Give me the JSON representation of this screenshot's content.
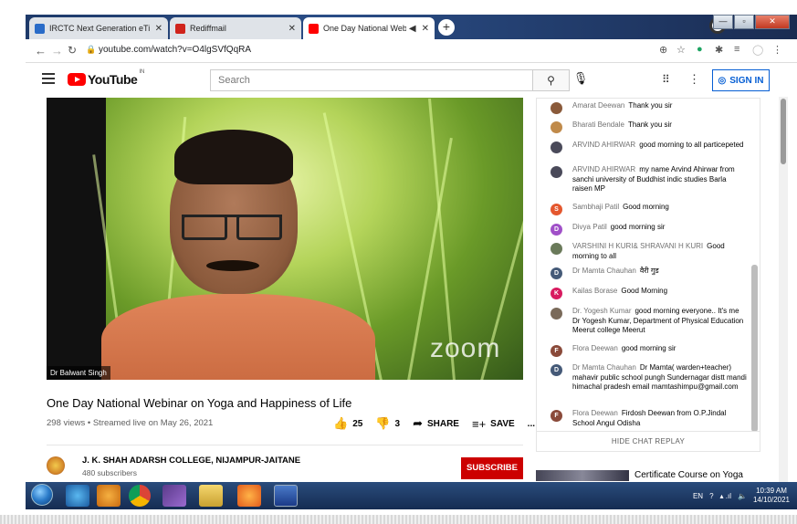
{
  "browser": {
    "tabs": [
      {
        "label": "IRCTC Next Generation eTicketing",
        "favicon_color": "#2a6cc8",
        "active": false
      },
      {
        "label": "Rediffmail",
        "favicon_color": "#d0241c",
        "active": false
      },
      {
        "label": "One Day National Webinar on",
        "favicon_color": "#ff0000",
        "active": true
      }
    ],
    "url": "youtube.com/watch?v=O4lgSVfQqRA",
    "new_tab_glyph": "+"
  },
  "youtube": {
    "logo_text": "YouTube",
    "country_code": "IN",
    "search_placeholder": "Search",
    "sign_in_label": "SIGN IN"
  },
  "video": {
    "speaker_tag": "Dr Balwant Singh",
    "watermark": "zoom",
    "title": "One Day National Webinar on Yoga and Happiness of Life",
    "meta": "298 views • Streamed live on May 26, 2021",
    "likes": "25",
    "dislikes": "3",
    "share_label": "SHARE",
    "save_label": "SAVE",
    "more_label": "..."
  },
  "channel": {
    "name": "J. K. SHAH ADARSH COLLEGE, NIJAMPUR-JAITANE",
    "subscribers": "480 subscribers",
    "subscribe_label": "SUBSCRIBE"
  },
  "chat": {
    "hide_label": "HIDE CHAT REPLAY",
    "messages": [
      {
        "author": "Amarat Deewan",
        "text": "Thank you sir",
        "avatar": "",
        "color": "#8a5a3a"
      },
      {
        "author": "Bharati Bendale",
        "text": "Thank you sir",
        "avatar": "",
        "color": "#c08a4a"
      },
      {
        "author": "ARVIND AHIRWAR",
        "text": "good morning to all particepeted",
        "avatar": "",
        "color": "#4a4a5a"
      },
      {
        "author": "ARVIND AHIRWAR",
        "text": "my name Arvind Ahirwar from sanchi university of Buddhist indic studies Barla raisen MP",
        "avatar": "",
        "color": "#4a4a5a"
      },
      {
        "author": "Sambhaji Patil",
        "text": "Good morning",
        "avatar": "S",
        "color": "#e4572e"
      },
      {
        "author": "Divya Patil",
        "text": "good morning sir",
        "avatar": "D",
        "color": "#a050c8"
      },
      {
        "author": "VARSHINI H KURI& SHRAVANI H KURI",
        "text": "Good morning to all",
        "avatar": "",
        "color": "#6a7a5a"
      },
      {
        "author": "Dr Mamta Chauhan",
        "text": "वैरी गुड",
        "avatar": "D",
        "color": "#455a78"
      },
      {
        "author": "Kailas Borase",
        "text": "Good Morning",
        "avatar": "K",
        "color": "#d81b60"
      },
      {
        "author": "Dr. Yogesh Kumar",
        "text": "good morning everyone.. It's me Dr Yogesh Kumar, Department of Physical Education Meerut college Meerut",
        "avatar": "",
        "color": "#7a6a5a"
      },
      {
        "author": "Flora Deewan",
        "text": "good morning sir",
        "avatar": "F",
        "color": "#8a4a3a"
      },
      {
        "author": "Dr Mamta Chauhan",
        "text": "Dr Mamta( warden+teacher) mahavir public school pungh Sundernagar distt mandi himachal pradesh email mamtashimpu@gmail.com",
        "avatar": "D",
        "color": "#455a78"
      },
      {
        "author": "Flora Deewan",
        "text": "Firdosh Deewan from O.P.Jindal School Angul Odisha",
        "avatar": "F",
        "color": "#8a4a3a"
      }
    ]
  },
  "related": {
    "title": "Certificate Course on Yoga"
  },
  "taskbar": {
    "lang": "EN",
    "time": "10:39 AM",
    "date": "14/10/2021"
  }
}
